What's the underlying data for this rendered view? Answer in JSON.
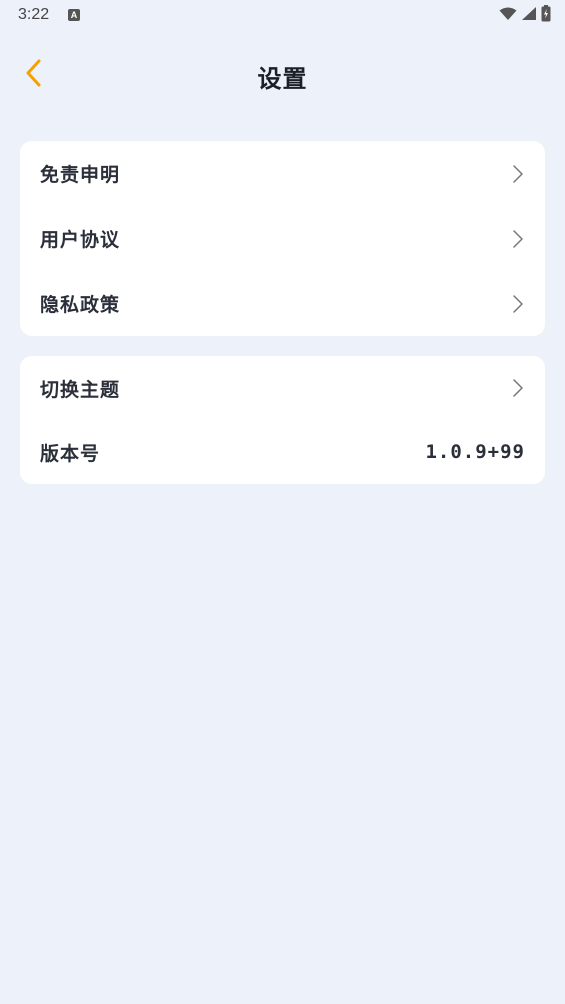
{
  "status_bar": {
    "time": "3:22",
    "notification_icon": "A"
  },
  "header": {
    "title": "设置",
    "back_icon": "chevron-left-icon"
  },
  "colors": {
    "accent": "#f5a100",
    "background": "#edf1f9",
    "card": "#ffffff",
    "text": "#2a2f3a"
  },
  "settings_group_1": {
    "items": [
      {
        "label": "免责申明"
      },
      {
        "label": "用户协议"
      },
      {
        "label": "隐私政策"
      }
    ]
  },
  "settings_group_2": {
    "theme": {
      "label": "切换主题"
    },
    "version": {
      "label": "版本号",
      "value": "1.0.9+99"
    }
  }
}
